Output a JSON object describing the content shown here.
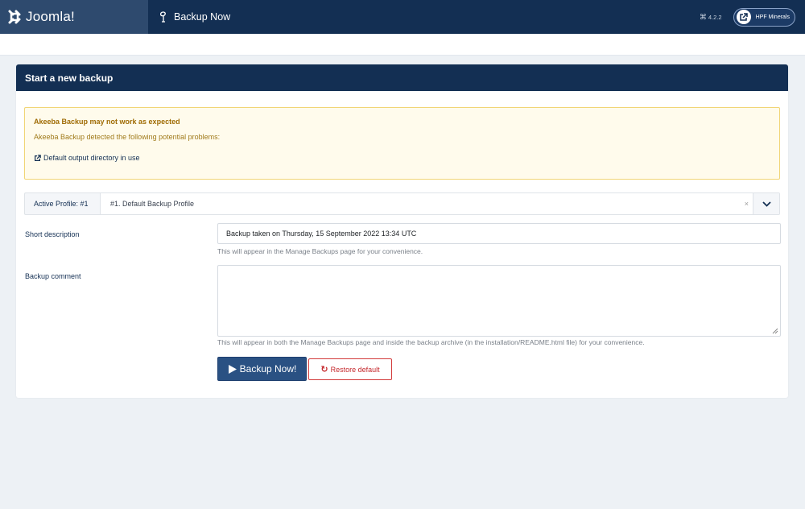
{
  "header": {
    "logo_text": "Joomla!",
    "page_title": "Backup Now",
    "version": "4.2.2",
    "site_button_label": "HPF Minerals"
  },
  "card": {
    "title": "Start a new backup"
  },
  "alert": {
    "title": "Akeeba Backup may not work as expected",
    "body": "Akeeba Backup detected the following potential problems:",
    "link_text": "Default output directory in use"
  },
  "profile": {
    "label": "Active Profile: #1",
    "selected": "#1. Default Backup Profile",
    "clear_symbol": "×"
  },
  "form": {
    "short_description_label": "Short description",
    "short_description_value": "Backup taken on Thursday, 15 September 2022 13:34 UTC",
    "short_description_help": "This will appear in the Manage Backups page for your convenience.",
    "comment_label": "Backup comment",
    "comment_value": "",
    "comment_help": "This will appear in both the Manage Backups page and inside the backup archive (in the installation/README.html file) for your convenience."
  },
  "buttons": {
    "backup_now": "Backup Now!",
    "restore_default": "Restore default"
  },
  "colors": {
    "header_bg": "#132f53",
    "logo_bg": "#2e4a6e",
    "primary": "#2a5183",
    "danger": "#c5282c",
    "warning_bg": "#fffbec",
    "warning_border": "#f1d576"
  },
  "icons": {
    "logo": "joomla-logo-icon",
    "title": "akeeba-icon",
    "site": "external-link-icon",
    "alert_link": "external-link-icon",
    "select_toggle": "chevron-down-icon",
    "backup": "play-icon",
    "restore": "refresh-icon"
  }
}
